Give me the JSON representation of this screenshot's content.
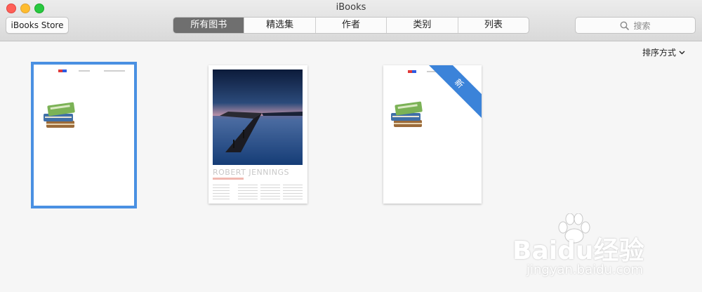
{
  "window": {
    "title": "iBooks"
  },
  "toolbar": {
    "store_label": "iBooks Store",
    "tabs": [
      "所有图书",
      "精选集",
      "作者",
      "类别",
      "列表"
    ],
    "active_tab_index": 0,
    "search_placeholder": "搜索"
  },
  "sort": {
    "label": "排序方式"
  },
  "books": [
    {
      "selected": true
    },
    {
      "author_text": "ROBERT JENNINGS"
    },
    {
      "badge": "新"
    }
  ],
  "watermark": {
    "brand": "Baidu经验",
    "url": "jingyan.baidu.com"
  }
}
